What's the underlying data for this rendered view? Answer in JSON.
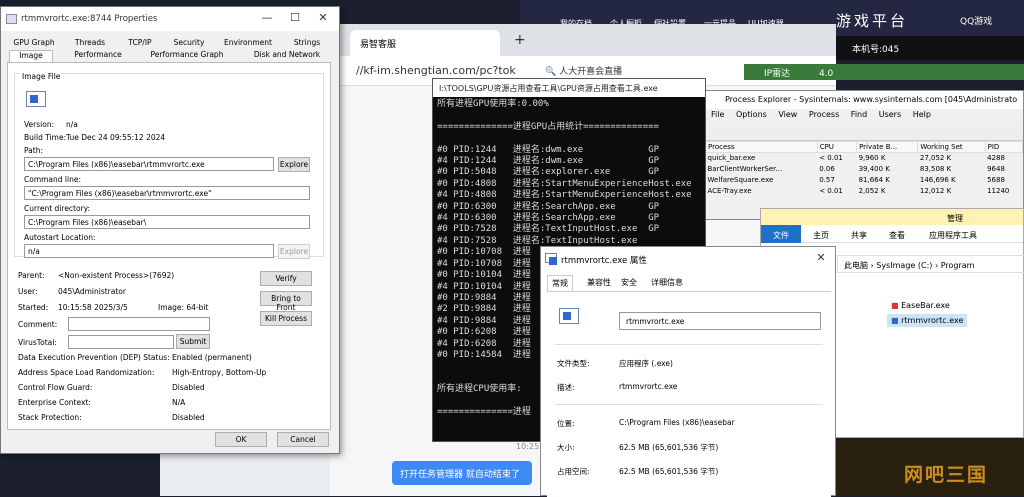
{
  "game": {
    "top_items": [
      "我的存档",
      "个人橱柜",
      "個社設置",
      "一元提品",
      "UU加速器"
    ],
    "platform": "游戏平台",
    "right_label": "QQ游戏",
    "machine_no": "本机号:045",
    "watermark": "网吧三国"
  },
  "browser": {
    "tab_title": "易智客服",
    "new_tab": "+",
    "url": "//kf-im.shengtian.com/pc?tok",
    "search_text": "人大开喜会直播",
    "chat_time": "10:25:32",
    "chat_message": "打开任务管理器 就自动结束了"
  },
  "console": {
    "title": "I:\\TOOLS\\GPU资源占用查看工具\\GPU资源占用查看工具.exe",
    "lines": [
      "所有进程GPU使用率:0.00%",
      "",
      "==============进程GPU占用统计==============",
      "",
      "#0 PID:1244   进程名:dwm.exe            GP",
      "#4 PID:1244   进程名:dwm.exe            GP",
      "#0 PID:5048   进程名:explorer.exe       GP",
      "#0 PID:4808   进程名:StartMenuExperienceHost.exe",
      "#4 PID:4808   进程名:StartMenuExperienceHost.exe",
      "#0 PID:6300   进程名:SearchApp.exe      GP",
      "#4 PID:6300   进程名:SearchApp.exe      GP",
      "#0 PID:7528   进程名:TextInputHost.exe  GP",
      "#4 PID:7528   进程名:TextInputHost.exe",
      "#0 PID:10708  进程",
      "#4 PID:10708  进程",
      "#0 PID:10104  进程",
      "#4 PID:10104  进程",
      "#0 PID:9884   进程",
      "#2 PID:9884   进程",
      "#4 PID:9884   进程",
      "#0 PID:6208   进程",
      "#4 PID:6208   进程",
      "#0 PID:14584  进程",
      "",
      "",
      "所有进程CPU使用率:",
      "",
      "==============进程"
    ]
  },
  "ip_radar": {
    "label": "IP雷达",
    "version": "4.0"
  },
  "procexp": {
    "title": "Process Explorer - Sysinternals: www.sysinternals.com [045\\Administrato",
    "menu": [
      "File",
      "Options",
      "View",
      "Process",
      "Find",
      "Users",
      "Help"
    ],
    "columns": [
      "Process",
      "CPU",
      "Private B...",
      "Working Set",
      "PID"
    ],
    "rows": [
      [
        "quick_bar.exe",
        "< 0.01",
        "9,960 K",
        "27,052 K",
        "4288"
      ],
      [
        "BarClientWorkerSer...",
        "0.06",
        "39,400 K",
        "83,508 K",
        "9648"
      ],
      [
        "WelfareSquare.exe",
        "0.57",
        "81,664 K",
        "146,696 K",
        "5688"
      ],
      [
        "ACE-Tray.exe",
        "< 0.01",
        "2,052 K",
        "12,012 K",
        "11240"
      ]
    ]
  },
  "fexplorer": {
    "manage": "管理",
    "ribbon": [
      "文件",
      "主页",
      "共享",
      "查看",
      "应用程序工具"
    ],
    "breadcrumb": [
      "此电脑",
      "SysImage (C:)",
      "Program"
    ],
    "files": [
      "EaseBar.exe",
      "rtmmvrortc.exe"
    ]
  },
  "props": {
    "title": "rtmmvrortc.exe:8744 Properties",
    "tabs_row1": [
      "GPU Graph",
      "Threads",
      "TCP/IP",
      "Security",
      "Environment",
      "Strings"
    ],
    "tabs_row2": [
      "Image",
      "Performance",
      "Performance Graph",
      "Disk and Network"
    ],
    "image_file_label": "Image File",
    "version_label": "Version:",
    "version_value": "n/a",
    "build_time_label": "Build Time:",
    "build_time_value": "Tue Dec 24 09:55:12 2024",
    "path_label": "Path:",
    "path_value": "C:\\Program Files (x86)\\easebar\\rtmmvrortc.exe",
    "explore_label": "Explore",
    "cmdline_label": "Command line:",
    "cmdline_value": "\"C:\\Program Files (x86)\\easebar\\rtmmvrortc.exe\"",
    "curdir_label": "Current directory:",
    "curdir_value": "C:\\Program Files (x86)\\easebar\\",
    "autostart_label": "Autostart Location:",
    "autostart_value": "n/a",
    "autostart_explore": "Explore",
    "parent_label": "Parent:",
    "parent_value": "<Non-existent Process>(7692)",
    "verify_label": "Verify",
    "user_label": "User:",
    "user_value": "045\\Administrator",
    "bring_label": "Bring to Front",
    "started_label": "Started:",
    "started_value": "10:15:58   2025/3/5",
    "image_bits": "Image: 64-bit",
    "kill_label": "Kill Process",
    "comment_label": "Comment:",
    "virustotal_label": "VirusTotal:",
    "submit_label": "Submit",
    "dep_label": "Data Execution Prevention (DEP) Status:",
    "dep_value": "Enabled (permanent)",
    "aslr_label": "Address Space Load Randomization:",
    "aslr_value": "High-Entropy, Bottom-Up",
    "cfg_label": "Control Flow Guard:",
    "cfg_value": "Disabled",
    "enterprise_label": "Enterprise Context:",
    "enterprise_value": "N/A",
    "stack_label": "Stack Protection:",
    "stack_value": "Disabled",
    "ok_label": "OK",
    "cancel_label": "Cancel"
  },
  "cnprops": {
    "title": "rtmmvrortc.exe 属性",
    "tabs": [
      "常规",
      "兼容性",
      "安全",
      "详细信息"
    ],
    "name": "rtmmvrortc.exe",
    "type_label": "文件类型:",
    "type_value": "应用程序 (.exe)",
    "desc_label": "描述:",
    "desc_value": "rtmmvrortc.exe",
    "loc_label": "位置:",
    "loc_value": "C:\\Program Files (x86)\\easebar",
    "size_label": "大小:",
    "size_value": "62.5 MB (65,601,536 字节)",
    "disk_label": "占用空间:",
    "disk_value": "62.5 MB (65,601,536 字节)"
  }
}
